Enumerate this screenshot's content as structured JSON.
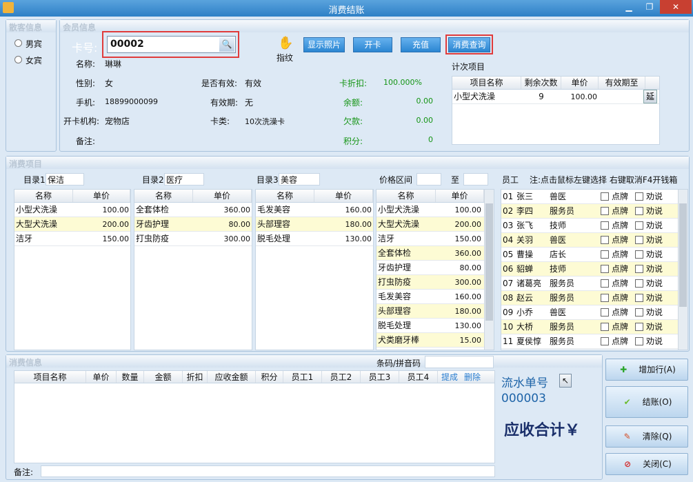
{
  "window": {
    "title": "消费结账"
  },
  "guest": {
    "header": "散客信息",
    "male": "男宾",
    "female": "女宾"
  },
  "member": {
    "header": "会员信息",
    "card_label": "卡号:",
    "card_value": "00002",
    "fingerprint": "指纹",
    "buttons": {
      "photo": "显示照片",
      "open_card": "开卡",
      "recharge": "充值",
      "query": "消费查询"
    },
    "name_label": "名称:",
    "name": "琳琳",
    "gender_label": "性别:",
    "gender": "女",
    "phone_label": "手机:",
    "phone": "18899000099",
    "org_label": "开卡机构:",
    "org": "宠物店",
    "remark_label": "备注:",
    "valid_label": "是否有效:",
    "valid": "有效",
    "expiry_label": "有效期:",
    "expiry": "无",
    "cardtype_label": "卡类:",
    "cardtype": "10次洗澡卡",
    "discount_label": "卡折扣:",
    "discount": "100.000%",
    "balance_label": "余额:",
    "balance": "0.00",
    "owed_label": "欠款:",
    "owed": "0.00",
    "points_label": "积分:",
    "points": "0",
    "count_items_label": "计次项目",
    "count_cols": [
      "项目名称",
      "剩余次数",
      "单价",
      "有效期至"
    ],
    "count_rows": [
      {
        "name": "小型犬洗澡",
        "remain": "9",
        "price": "100.00",
        "expire": ""
      }
    ],
    "extend_btn": "延"
  },
  "items": {
    "header": "消费项目",
    "cat_cols": [
      "名称",
      "单价"
    ],
    "cat1": {
      "label": "目录1",
      "name": "保洁",
      "rows": [
        {
          "n": "小型犬洗澡",
          "p": "100.00"
        },
        {
          "n": "大型犬洗澡",
          "p": "200.00"
        },
        {
          "n": "洁牙",
          "p": "150.00"
        }
      ]
    },
    "cat2": {
      "label": "目录2",
      "name": "医疗",
      "rows": [
        {
          "n": "全套体检",
          "p": "360.00"
        },
        {
          "n": "牙齿护理",
          "p": "80.00"
        },
        {
          "n": "打虫防疫",
          "p": "300.00"
        }
      ]
    },
    "cat3": {
      "label": "目录3",
      "name": "美容",
      "rows": [
        {
          "n": "毛发美容",
          "p": "160.00"
        },
        {
          "n": "头部理容",
          "p": "180.00"
        },
        {
          "n": "脱毛处理",
          "p": "130.00"
        }
      ]
    },
    "price_range_label": "价格区间",
    "to_label": "至",
    "all": [
      {
        "n": "小型犬洗澡",
        "p": "100.00"
      },
      {
        "n": "大型犬洗澡",
        "p": "200.00"
      },
      {
        "n": "洁牙",
        "p": "150.00"
      },
      {
        "n": "全套体检",
        "p": "360.00"
      },
      {
        "n": "牙齿护理",
        "p": "80.00"
      },
      {
        "n": "打虫防疫",
        "p": "300.00"
      },
      {
        "n": "毛发美容",
        "p": "160.00"
      },
      {
        "n": "头部理容",
        "p": "180.00"
      },
      {
        "n": "脱毛处理",
        "p": "130.00"
      },
      {
        "n": "犬类磨牙棒",
        "p": "15.00"
      }
    ],
    "staff_label": "员工",
    "staff_note": "注:点击鼠标左键选择 右键取消F4开钱箱",
    "pick_label": "点牌",
    "persuade_label": "劝说",
    "staff": [
      {
        "id": "01",
        "name": "张三",
        "role": "兽医"
      },
      {
        "id": "02",
        "name": "李四",
        "role": "服务员"
      },
      {
        "id": "03",
        "name": "张飞",
        "role": "技师"
      },
      {
        "id": "04",
        "name": "关羽",
        "role": "兽医"
      },
      {
        "id": "05",
        "name": "曹操",
        "role": "店长"
      },
      {
        "id": "06",
        "name": "貂蝉",
        "role": "技师"
      },
      {
        "id": "07",
        "name": "诸葛亮",
        "role": "服务员"
      },
      {
        "id": "08",
        "name": "赵云",
        "role": "服务员"
      },
      {
        "id": "09",
        "name": "小乔",
        "role": "兽医"
      },
      {
        "id": "10",
        "name": "大桥",
        "role": "服务员"
      },
      {
        "id": "11",
        "name": "夏侯惇",
        "role": "服务员"
      }
    ]
  },
  "consume": {
    "header": "消费信息",
    "barcode_label": "条码/拼音码",
    "cols": [
      "项目名称",
      "单价",
      "数量",
      "金额",
      "折扣",
      "应收金额",
      "积分",
      "员工1",
      "员工2",
      "员工3",
      "员工4"
    ],
    "commission": "提成",
    "delete": "删除",
    "remark_label": "备注:",
    "serial_label": "流水单号",
    "serial": "000003",
    "total_label": "应收合计￥"
  },
  "actions": {
    "add": "增加行(A)",
    "checkout": "结账(O)",
    "clear": "清除(Q)",
    "close": "关闭(C)"
  }
}
